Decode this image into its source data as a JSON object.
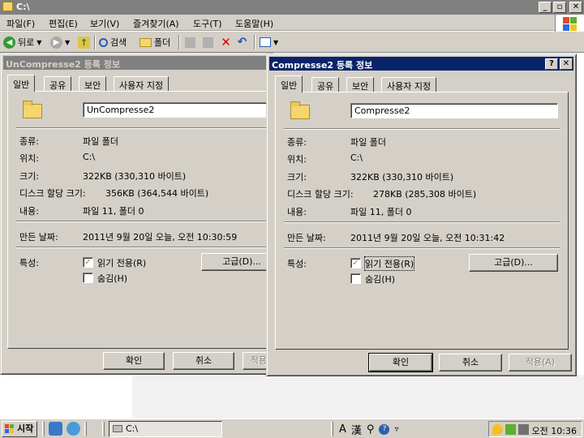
{
  "explorer": {
    "title": "C:\\",
    "menu": [
      "파일(F)",
      "편집(E)",
      "보기(V)",
      "즐겨찾기(A)",
      "도구(T)",
      "도움말(H)"
    ],
    "toolbar": {
      "back": "뒤로",
      "search": "검색",
      "folders": "폴더"
    }
  },
  "dialog_left": {
    "title": "UnCompresse2 등록 정보",
    "tabs": [
      "일반",
      "공유",
      "보안",
      "사용자 지정"
    ],
    "name": "UnCompresse2",
    "rows": [
      {
        "label": "종류:",
        "value": "파일 폴더"
      },
      {
        "label": "위치:",
        "value": "C:\\"
      },
      {
        "label": "크기:",
        "value": "322KB (330,310 바이트)"
      },
      {
        "label": "디스크 할당 크기:",
        "value": "356KB (364,544 바이트)"
      },
      {
        "label": "내용:",
        "value": "파일 11, 폴더 0"
      }
    ],
    "created_label": "만든 날짜:",
    "created_value": "2011년 9월 20일 오늘, 오전 10:30:59",
    "attr_label": "특성:",
    "readonly_label": "읽기 전용(R)",
    "hidden_label": "숨김(H)",
    "advanced_label": "고급(D)...",
    "ok": "확인",
    "cancel": "취소",
    "apply": "적용"
  },
  "dialog_right": {
    "title": "Compresse2 등록 정보",
    "tabs": [
      "일반",
      "공유",
      "보안",
      "사용자 지정"
    ],
    "name": "Compresse2",
    "rows": [
      {
        "label": "종류:",
        "value": "파일 폴더"
      },
      {
        "label": "위치:",
        "value": "C:\\"
      },
      {
        "label": "크기:",
        "value": "322KB (330,310 바이트)"
      },
      {
        "label": "디스크 할당 크기:",
        "value": "278KB (285,308 바이트)"
      },
      {
        "label": "내용:",
        "value": "파일 11, 폴더 0"
      }
    ],
    "created_label": "만든 날짜:",
    "created_value": "2011년 9월 20일 오늘, 오전 10:31:42",
    "attr_label": "특성:",
    "readonly_label": "읽기 전용(R)",
    "hidden_label": "숨김(H)",
    "advanced_label": "고급(D)...",
    "ok": "확인",
    "cancel": "취소",
    "apply": "적용(A)"
  },
  "taskbar": {
    "start": "시작",
    "task": "C:\\",
    "clock": "오전 10:36",
    "lang_a": "A",
    "lang_han": "漢"
  },
  "colors": {
    "face": "#d4d0c8",
    "active_title": "#0a246a",
    "inactive_title": "#808080"
  }
}
